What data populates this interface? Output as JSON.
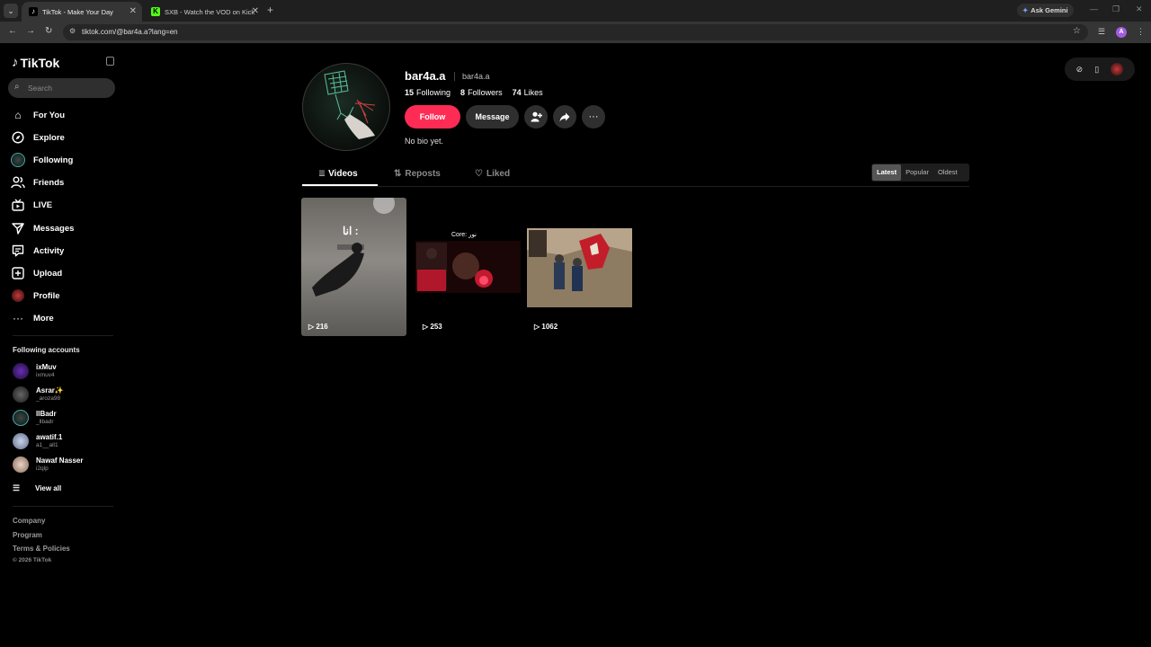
{
  "browser": {
    "tabs": [
      {
        "title": "TikTok - Make Your Day",
        "active": true
      },
      {
        "title": "SXB - Watch the VOD on Kick",
        "active": false
      }
    ],
    "ask_gemini": "Ask Gemini",
    "url": "tiktok.com/@bar4a.a?lang=en",
    "profile_initial": "A"
  },
  "sidebar": {
    "logo": "TikTok",
    "search_placeholder": "Search",
    "nav": [
      {
        "label": "For You",
        "icon": "home-icon"
      },
      {
        "label": "Explore",
        "icon": "compass-icon"
      },
      {
        "label": "Following",
        "icon": "following-avatar"
      },
      {
        "label": "Friends",
        "icon": "friends-icon"
      },
      {
        "label": "LIVE",
        "icon": "live-icon"
      },
      {
        "label": "Messages",
        "icon": "messages-icon"
      },
      {
        "label": "Activity",
        "icon": "activity-icon"
      },
      {
        "label": "Upload",
        "icon": "upload-icon"
      },
      {
        "label": "Profile",
        "icon": "profile-avatar"
      },
      {
        "label": "More",
        "icon": "more-icon"
      }
    ],
    "following_title": "Following accounts",
    "accounts": [
      {
        "name": "ixMuv",
        "username": "ixmuv4"
      },
      {
        "name": "Asrar✨",
        "username": "_aroza98"
      },
      {
        "name": "lIBadr",
        "username": "_llbadr"
      },
      {
        "name": "awatif.1",
        "username": "a1__all1"
      },
      {
        "name": "Nawaf Nasser",
        "username": "i2qlp"
      }
    ],
    "view_all": "View all",
    "footer": [
      "Company",
      "Program",
      "Terms & Policies"
    ],
    "copyright": "© 2026 TikTok"
  },
  "profile": {
    "username": "bar4a.a",
    "handle": "bar4a.a",
    "following_count": "15",
    "following_label": "Following",
    "followers_count": "8",
    "followers_label": "Followers",
    "likes_count": "74",
    "likes_label": "Likes",
    "follow_label": "Follow",
    "message_label": "Message",
    "bio": "No bio yet."
  },
  "tabs": {
    "videos": "Videos",
    "reposts": "Reposts",
    "liked": "Liked"
  },
  "sort": {
    "latest": "Latest",
    "popular": "Popular",
    "oldest": "Oldest",
    "selected": "Latest"
  },
  "videos": [
    {
      "caption": "انا :",
      "views": "216"
    },
    {
      "caption": "Core: نور",
      "views": "253"
    },
    {
      "caption": "",
      "views": "1062"
    }
  ],
  "colors": {
    "accent": "#fe2c55",
    "background": "#000000"
  }
}
